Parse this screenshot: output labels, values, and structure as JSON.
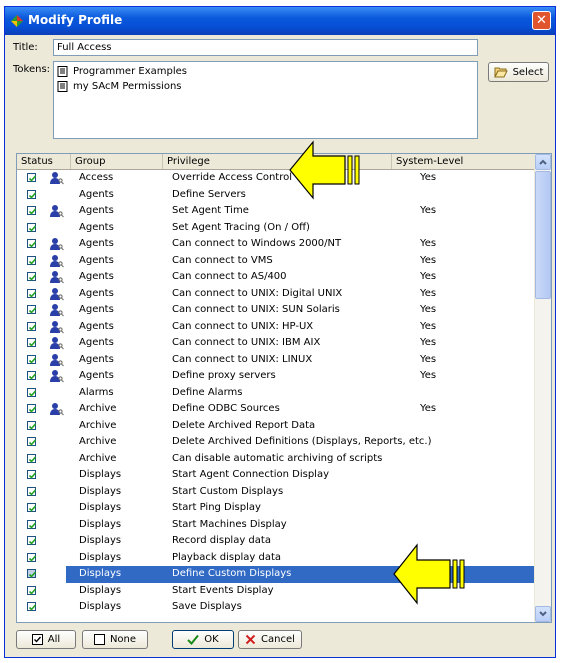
{
  "window": {
    "title": "Modify Profile",
    "close_glyph": "✕"
  },
  "title_field": {
    "label": "Title:",
    "value": "Full Access"
  },
  "tokens": {
    "label": "Tokens:",
    "items": [
      {
        "label": "Programmer Examples",
        "icon": "document-icon"
      },
      {
        "label": "my SAcM Permissions",
        "icon": "document-icon"
      }
    ],
    "select_label": "Select"
  },
  "grid": {
    "headers": [
      "Status",
      "Group",
      "Privilege",
      "System-Level"
    ],
    "rows": [
      {
        "checked": true,
        "user_icon": true,
        "group": "Access",
        "privilege": "Override Access Control",
        "system": "Yes"
      },
      {
        "checked": true,
        "user_icon": false,
        "group": "Agents",
        "privilege": "Define Servers",
        "system": ""
      },
      {
        "checked": true,
        "user_icon": true,
        "group": "Agents",
        "privilege": "Set Agent Time",
        "system": "Yes"
      },
      {
        "checked": true,
        "user_icon": false,
        "group": "Agents",
        "privilege": "Set Agent Tracing (On / Off)",
        "system": ""
      },
      {
        "checked": true,
        "user_icon": true,
        "group": "Agents",
        "privilege": "Can connect to Windows 2000/NT",
        "system": "Yes"
      },
      {
        "checked": true,
        "user_icon": true,
        "group": "Agents",
        "privilege": "Can connect to VMS",
        "system": "Yes"
      },
      {
        "checked": true,
        "user_icon": true,
        "group": "Agents",
        "privilege": "Can connect to AS/400",
        "system": "Yes"
      },
      {
        "checked": true,
        "user_icon": true,
        "group": "Agents",
        "privilege": "Can connect to UNIX: Digital UNIX",
        "system": "Yes"
      },
      {
        "checked": true,
        "user_icon": true,
        "group": "Agents",
        "privilege": "Can connect to UNIX: SUN Solaris",
        "system": "Yes"
      },
      {
        "checked": true,
        "user_icon": true,
        "group": "Agents",
        "privilege": "Can connect to UNIX: HP-UX",
        "system": "Yes"
      },
      {
        "checked": true,
        "user_icon": true,
        "group": "Agents",
        "privilege": "Can connect to UNIX: IBM AIX",
        "system": "Yes"
      },
      {
        "checked": true,
        "user_icon": true,
        "group": "Agents",
        "privilege": "Can connect to UNIX: LINUX",
        "system": "Yes"
      },
      {
        "checked": true,
        "user_icon": true,
        "group": "Agents",
        "privilege": "Define proxy servers",
        "system": "Yes"
      },
      {
        "checked": true,
        "user_icon": false,
        "group": "Alarms",
        "privilege": "Define Alarms",
        "system": ""
      },
      {
        "checked": true,
        "user_icon": true,
        "group": "Archive",
        "privilege": "Define ODBC Sources",
        "system": "Yes"
      },
      {
        "checked": true,
        "user_icon": false,
        "group": "Archive",
        "privilege": "Delete Archived Report Data",
        "system": ""
      },
      {
        "checked": true,
        "user_icon": false,
        "group": "Archive",
        "privilege": "Delete Archived Definitions (Displays, Reports, etc.)",
        "system": ""
      },
      {
        "checked": true,
        "user_icon": false,
        "group": "Archive",
        "privilege": "Can disable automatic archiving of scripts",
        "system": ""
      },
      {
        "checked": true,
        "user_icon": false,
        "group": "Displays",
        "privilege": "Start Agent Connection Display",
        "system": ""
      },
      {
        "checked": true,
        "user_icon": false,
        "group": "Displays",
        "privilege": "Start Custom Displays",
        "system": ""
      },
      {
        "checked": true,
        "user_icon": false,
        "group": "Displays",
        "privilege": "Start Ping Display",
        "system": ""
      },
      {
        "checked": true,
        "user_icon": false,
        "group": "Displays",
        "privilege": "Start Machines Display",
        "system": ""
      },
      {
        "checked": true,
        "user_icon": false,
        "group": "Displays",
        "privilege": "Record display data",
        "system": ""
      },
      {
        "checked": true,
        "user_icon": false,
        "group": "Displays",
        "privilege": "Playback display data",
        "system": ""
      },
      {
        "checked": true,
        "user_icon": false,
        "group": "Displays",
        "privilege": "Define Custom Displays",
        "system": "",
        "selected": true
      },
      {
        "checked": true,
        "user_icon": false,
        "group": "Displays",
        "privilege": "Start Events Display",
        "system": ""
      },
      {
        "checked": true,
        "user_icon": false,
        "group": "Displays",
        "privilege": "Save Displays",
        "system": ""
      }
    ]
  },
  "footer": {
    "all_label": "All",
    "none_label": "None",
    "ok_label": "OK",
    "cancel_label": "Cancel"
  },
  "colors": {
    "selection": "#316ac5",
    "arrow": "#ffff00",
    "titlebar": "#0650d6"
  }
}
